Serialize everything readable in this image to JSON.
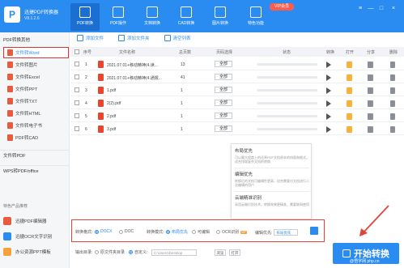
{
  "header": {
    "app_title": "迅捷PDF转换器",
    "version": "V8.1.2.6",
    "tabs": [
      {
        "label": "PDF转换",
        "icon": "pdf-convert-icon",
        "active": true
      },
      {
        "label": "PDF操作",
        "icon": "pdf-operate-icon",
        "active": false
      },
      {
        "label": "文档转换",
        "icon": "doc-convert-icon",
        "active": false
      },
      {
        "label": "CAD转换",
        "icon": "cad-convert-icon",
        "active": false
      },
      {
        "label": "图片转换",
        "icon": "image-convert-icon",
        "active": false
      },
      {
        "label": "特色功能",
        "icon": "feature-icon",
        "active": false
      }
    ],
    "badge": "VIP会员",
    "window_buttons": [
      "≡",
      "—",
      "□",
      "×"
    ]
  },
  "sidebar": {
    "group_main": "PDF转换其他",
    "items": [
      {
        "label": "文件转Word",
        "selected": true
      },
      {
        "label": "文件转图片",
        "selected": false
      },
      {
        "label": "文件转Excel",
        "selected": false
      },
      {
        "label": "文件转PPT",
        "selected": false
      },
      {
        "label": "文件转TXT",
        "selected": false
      },
      {
        "label": "文件转HTML",
        "selected": false
      },
      {
        "label": "文件转电子书",
        "selected": false
      },
      {
        "label": "PDF转CAD",
        "selected": false
      }
    ],
    "group_to_pdf": "文件转PDF",
    "group_wps": "WPS转PDF/office",
    "group_tools": "特色产品推荐",
    "tools": [
      {
        "label": "迅捷PDF编辑器",
        "color": "#ea5a3c"
      },
      {
        "label": "迅捷OCR文字识别",
        "color": "#2a8bf0"
      },
      {
        "label": "办公资源PPT模板",
        "color": "#f4a23c"
      }
    ]
  },
  "toolbar": {
    "add_file": "添加文件",
    "add_folder": "添加文件夹",
    "clear_list": "清空列表"
  },
  "table": {
    "headers": [
      "序号",
      "文件名称",
      "总页数",
      "页码选择",
      "状态",
      "转换",
      "打开",
      "分享",
      "删除"
    ],
    "rows": [
      {
        "index": "1",
        "name": "2021.07.01+移动精神(4.读...",
        "pages": "13",
        "range": "全部",
        "progress": 0
      },
      {
        "index": "2",
        "name": "2021.07.01+移动精神(4.通报...",
        "pages": "41",
        "range": "全部",
        "progress": 0
      },
      {
        "index": "3",
        "name": "1.pdf",
        "pages": "1",
        "range": "全部",
        "progress": 0
      },
      {
        "index": "4",
        "name": "2(2).pdf",
        "pages": "1",
        "range": "全部",
        "progress": 0
      },
      {
        "index": "5",
        "name": "2.pdf",
        "pages": "1",
        "range": "全部",
        "progress": 0
      },
      {
        "index": "6",
        "name": "3.pdf",
        "pages": "1",
        "range": "全部",
        "progress": 0
      }
    ]
  },
  "tooltip": {
    "sections": [
      {
        "title": "布局优先",
        "desc": "可以最大程度上的还原PDF文档原本的排版和格式，适合排版复杂文档的转换"
      },
      {
        "title": "编辑优先",
        "desc": "转换后的文档可编辑性更高，适合需要对文档进行二次编辑的用户"
      },
      {
        "title": "云端精准识别",
        "desc": "采用云端识别技术，转换效果更精准，需要联网使用"
      }
    ]
  },
  "settings": {
    "format_label": "转换格式:",
    "format_opts": [
      {
        "label": "DOCX",
        "on": true
      },
      {
        "label": "DOC",
        "on": false
      }
    ],
    "mode_label": "转换模式:",
    "mode_opts": [
      {
        "label": "布局优先",
        "on": true
      },
      {
        "label": "可编辑",
        "on": false
      },
      {
        "label": "OCR识别",
        "on": false
      }
    ],
    "ocr_badge": "VIP",
    "priority_label": "编辑优先:",
    "priority_value": "布局优先"
  },
  "output": {
    "dir_label": "输出目录:",
    "opt_original": "原文件夹目录",
    "opt_custom": "自定义:",
    "path_placeholder": "C:\\Users\\Desktop",
    "browse_btn": "浏览",
    "open_btn": "打开"
  },
  "start_button": {
    "label": "开始转换",
    "watermark": "@悟字网 php.cn"
  },
  "colors": {
    "primary": "#2a8bf0",
    "highlight": "#e0453a",
    "pdf_red": "#e9452e"
  }
}
